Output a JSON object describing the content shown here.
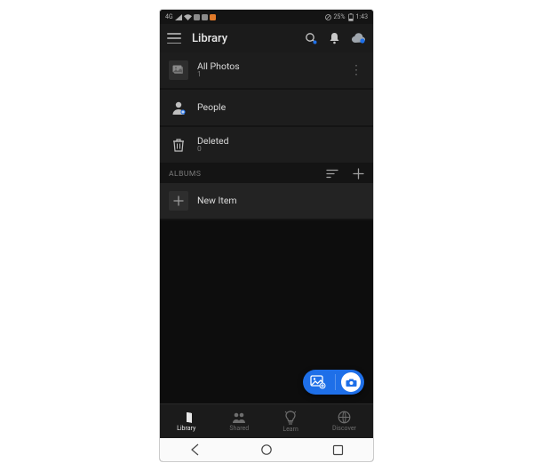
{
  "status": {
    "network_label": "4G",
    "battery": "25%",
    "time": "1:43"
  },
  "header": {
    "title": "Library"
  },
  "items": {
    "all_photos": {
      "label": "All Photos",
      "count": "1"
    },
    "people": {
      "label": "People"
    },
    "deleted": {
      "label": "Deleted",
      "count": "0"
    }
  },
  "albums": {
    "section_label": "ALBUMS",
    "new_item_label": "New Item"
  },
  "nav": {
    "library": "Library",
    "shared": "Shared",
    "learn": "Learn",
    "discover": "Discover"
  },
  "colors": {
    "accent": "#1e6fe8"
  }
}
